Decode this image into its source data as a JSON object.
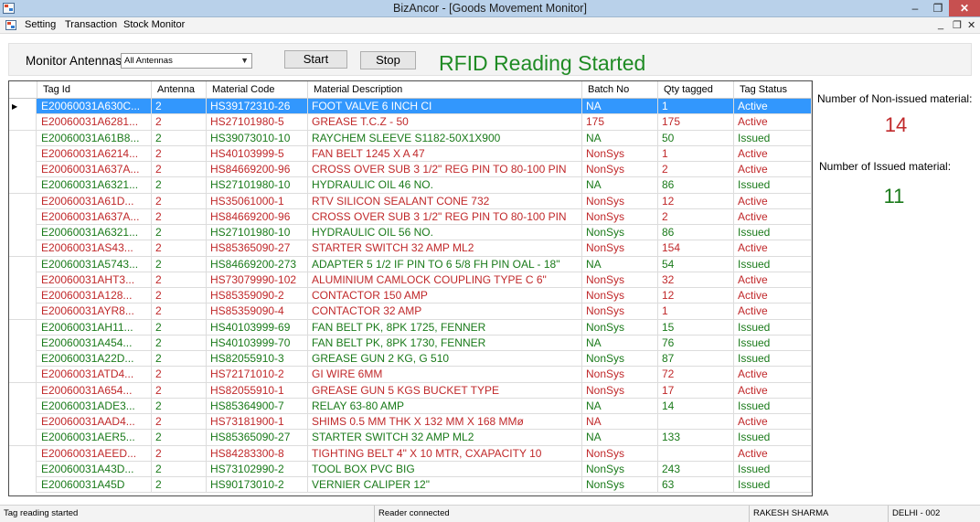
{
  "window": {
    "title": "BizAncor - [Goods Movement Monitor]",
    "min": "–",
    "max": "❐",
    "close": "✕"
  },
  "menu": {
    "items": [
      "Setting",
      "Transaction",
      "Stock Monitor"
    ],
    "mdi_min": "_",
    "mdi_restore": "❐",
    "mdi_close": "✕"
  },
  "controls": {
    "antenna_label": "Monitor Antennas",
    "antenna_selected": "All Antennas",
    "start": "Start",
    "stop": "Stop",
    "status": "RFID Reading Started"
  },
  "colors": {
    "issued": "#1a7a1a",
    "active": "#c0282a",
    "status_green": "#1f8b24",
    "selected": "#3297fd"
  },
  "columns": [
    "Tag Id",
    "Antenna",
    "Material Code",
    "Material Description",
    "Batch No",
    "Qty tagged",
    "Tag Status"
  ],
  "rows": [
    [
      "E20060031A630C...",
      "2",
      "HS39172310-26",
      "FOOT VALVE 6 INCH CI",
      "NA",
      "1",
      "Active"
    ],
    [
      "E20060031A6281...",
      "2",
      "HS27101980-5",
      "GREASE T.C.Z - 50",
      "175",
      "175",
      "Active"
    ],
    [
      "E20060031A61B8...",
      "2",
      "HS39073010-10",
      "RAYCHEM SLEEVE S1182-50X1X900",
      "NA",
      "50",
      "Issued"
    ],
    [
      "E20060031A6214...",
      "2",
      "HS40103999-5",
      "FAN BELT 1245 X A 47",
      "NonSys",
      "1",
      "Active"
    ],
    [
      "E20060031A637A...",
      "2",
      "HS84669200-96",
      "CROSS OVER SUB 3 1/2\" REG PIN TO 80-100 PIN",
      "NonSys",
      "2",
      "Active"
    ],
    [
      "E20060031A6321...",
      "2",
      "HS27101980-10",
      "HYDRAULIC OIL 46 NO.",
      "NA",
      "86",
      "Issued"
    ],
    [
      "E20060031A61D...",
      "2",
      "HS35061000-1",
      "RTV SILICON SEALANT CONE 732",
      "NonSys",
      "12",
      "Active"
    ],
    [
      "E20060031A637A...",
      "2",
      "HS84669200-96",
      "CROSS OVER SUB 3 1/2\" REG PIN TO 80-100 PIN",
      "NonSys",
      "2",
      "Active"
    ],
    [
      "E20060031A6321...",
      "2",
      "HS27101980-10",
      "HYDRAULIC OIL 56 NO.",
      "NonSys",
      "86",
      "Issued"
    ],
    [
      "E20060031AS43...",
      "2",
      "HS85365090-27",
      "STARTER SWITCH 32 AMP ML2",
      "NonSys",
      "154",
      "Active"
    ],
    [
      "E20060031A5743...",
      "2",
      "HS84669200-273",
      "ADAPTER 5 1/2 IF PIN TO 6 5/8 FH PIN OAL - 18\"",
      "NA",
      "54",
      "Issued"
    ],
    [
      "E20060031AHT3...",
      "2",
      "HS73079990-102",
      "ALUMINIUM CAMLOCK COUPLING TYPE C 6\"",
      "NonSys",
      "32",
      "Active"
    ],
    [
      "E20060031A128...",
      "2",
      "HS85359090-2",
      "CONTACTOR 150 AMP",
      "NonSys",
      "12",
      "Active"
    ],
    [
      "E20060031AYR8...",
      "2",
      "HS85359090-4",
      "CONTACTOR 32 AMP",
      "NonSys",
      "1",
      "Active"
    ],
    [
      "E20060031AH11...",
      "2",
      "HS40103999-69",
      "FAN BELT PK, 8PK 1725, FENNER",
      "NonSys",
      "15",
      "Issued"
    ],
    [
      "E20060031A454...",
      "2",
      "HS40103999-70",
      "FAN BELT PK, 8PK 1730, FENNER",
      "NA",
      "76",
      "Issued"
    ],
    [
      "E20060031A22D...",
      "2",
      "HS82055910-3",
      "GREASE GUN 2 KG, G 510",
      "NonSys",
      "87",
      "Issued"
    ],
    [
      "E20060031ATD4...",
      "2",
      "HS72171010-2",
      "GI WIRE 6MM",
      "NonSys",
      "72",
      "Active"
    ],
    [
      "E20060031A654...",
      "2",
      "HS82055910-1",
      "GREASE GUN 5 KGS BUCKET TYPE",
      "NonSys",
      "17",
      "Active"
    ],
    [
      "E20060031ADE3...",
      "2",
      "HS85364900-7",
      "RELAY 63-80 AMP",
      "NA",
      "14",
      "Issued"
    ],
    [
      "E20060031AAD4...",
      "2",
      "HS73181900-1",
      "SHIMS 0.5 MM THK X 132 MM X 168 MMø",
      "NA",
      "",
      "Active"
    ],
    [
      "E20060031AER5...",
      "2",
      "HS85365090-27",
      "STARTER SWITCH 32 AMP ML2",
      "NA",
      "133",
      "Issued"
    ],
    [
      "E20060031AEED...",
      "2",
      "HS84283300-8",
      "TIGHTING BELT 4\" X 10 MTR, CXAPACITY 10",
      "NonSys",
      "",
      "Active"
    ],
    [
      "E20060031A43D...",
      "2",
      "HS73102990-2",
      "TOOL BOX PVC BIG",
      "NonSys",
      "243",
      "Issued"
    ],
    [
      "E20060031A45D",
      "2",
      "HS90173010-2",
      "VERNIER CALIPER 12\"",
      "NonSys",
      "63",
      "Issued"
    ]
  ],
  "summary": {
    "non_issued_label": "Number of Non-issued material:",
    "non_issued_count": "14",
    "issued_label": "Number of Issued material:",
    "issued_count": "11"
  },
  "statusbar": [
    "Tag reading started",
    "Reader connected",
    "RAKESH SHARMA",
    "DELHI - 002"
  ]
}
